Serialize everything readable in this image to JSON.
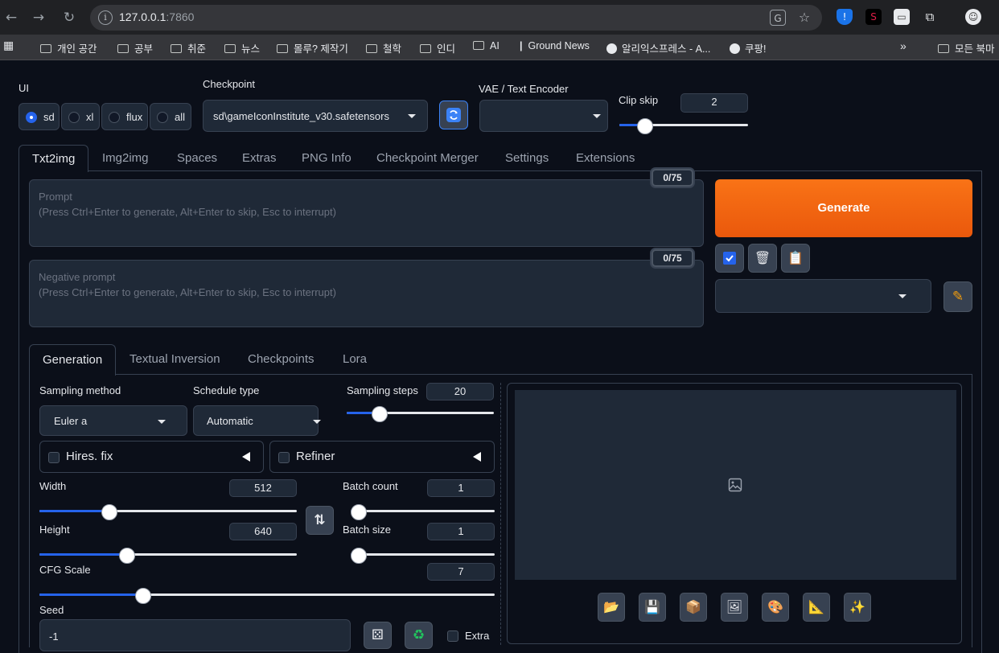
{
  "browser": {
    "url_host": "127.0.0.1",
    "url_port": ":7860",
    "bookmarks": [
      "개인 공간",
      "공부",
      "취준",
      "뉴스",
      "몰루? 제작기",
      "철학",
      "인디",
      "AI",
      "Ground News",
      "알리익스프레스 - A...",
      "쿠팡!",
      "»",
      "모든 북마"
    ]
  },
  "top": {
    "ui_label": "UI",
    "ui_options": [
      "sd",
      "xl",
      "flux",
      "all"
    ],
    "ui_selected": "sd",
    "checkpoint_label": "Checkpoint",
    "checkpoint_value": "sd\\gameIconInstitute_v30.safetensors",
    "vae_label": "VAE / Text Encoder",
    "vae_value": "",
    "clip_skip_label": "Clip skip",
    "clip_skip_value": "2",
    "clip_skip_fraction": 0.14
  },
  "main_tabs": [
    "Txt2img",
    "Img2img",
    "Spaces",
    "Extras",
    "PNG Info",
    "Checkpoint Merger",
    "Settings",
    "Extensions"
  ],
  "prompt": {
    "label": "Prompt",
    "hint": "(Press Ctrl+Enter to generate, Alt+Enter to skip, Esc to interrupt)",
    "token_count": "0/75"
  },
  "negative_prompt": {
    "label": "Negative prompt",
    "hint": "(Press Ctrl+Enter to generate, Alt+Enter to skip, Esc to interrupt)",
    "token_count": "0/75"
  },
  "generate_label": "Generate",
  "sub_tabs": [
    "Generation",
    "Textual Inversion",
    "Checkpoints",
    "Lora"
  ],
  "generation": {
    "sampling_method_label": "Sampling method",
    "sampling_method_value": "Euler a",
    "schedule_type_label": "Schedule type",
    "schedule_type_value": "Automatic",
    "sampling_steps_label": "Sampling steps",
    "sampling_steps_value": "20",
    "sampling_steps_fraction": 0.17,
    "hires_label": "Hires. fix",
    "refiner_label": "Refiner",
    "width_label": "Width",
    "width_value": "512",
    "width_fraction": 0.24,
    "height_label": "Height",
    "height_value": "640",
    "height_fraction": 0.31,
    "batch_count_label": "Batch count",
    "batch_count_value": "1",
    "batch_count_fraction": 0.0,
    "batch_size_label": "Batch size",
    "batch_size_value": "1",
    "batch_size_fraction": 0.0,
    "cfg_label": "CFG Scale",
    "cfg_value": "7",
    "cfg_fraction": 0.21,
    "seed_label": "Seed",
    "seed_value": "-1",
    "extra_label": "Extra"
  },
  "colors": {
    "accent": "#2563eb",
    "generate": "#ea580c",
    "background": "#0b0f19"
  }
}
